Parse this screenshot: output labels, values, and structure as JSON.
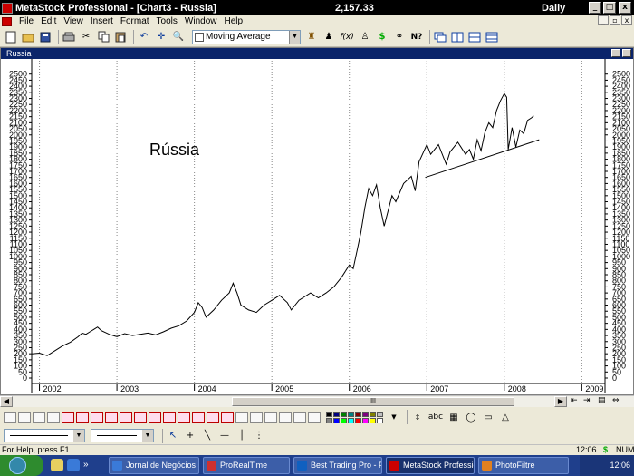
{
  "titlebar": {
    "title": "MetaStock Professional - [Chart3 - Russia]",
    "price": "2,157.33",
    "period": "Daily",
    "minimize": "_",
    "maximize": "□",
    "close": "x"
  },
  "menubar": {
    "items": [
      "File",
      "Edit",
      "View",
      "Insert",
      "Format",
      "Tools",
      "Window",
      "Help"
    ]
  },
  "toolbar": {
    "indicator_combo": "Moving Average",
    "fx_label": "f(x)",
    "dollar_label": "$",
    "help_label": "N?"
  },
  "chart_window": {
    "title": "Russia",
    "annotation": "Rússia"
  },
  "chart_data": {
    "type": "line",
    "title": "",
    "annotation": "Rússia",
    "xlabel": "",
    "ylabel": "",
    "x_tick_labels": [
      "2002",
      "2003",
      "2004",
      "2005",
      "2006",
      "2007",
      "2008",
      "2009"
    ],
    "y_ticks": [
      0,
      50,
      100,
      150,
      200,
      250,
      300,
      350,
      400,
      450,
      500,
      550,
      600,
      650,
      700,
      750,
      800,
      850,
      900,
      950,
      1000,
      1050,
      1100,
      1150,
      1200,
      1250,
      1300,
      1350,
      1400,
      1450,
      1500,
      1550,
      1600,
      1650,
      1700,
      1750,
      1800,
      1850,
      1900,
      1950,
      2000,
      2050,
      2100,
      2150,
      2200,
      2250,
      2300,
      2350,
      2400,
      2450,
      2500
    ],
    "ylim": [
      0,
      2550
    ],
    "xlim": [
      2001.9,
      2009.3
    ],
    "grid": "vertical dotted",
    "series": [
      {
        "points": [
          [
            2001.9,
            200
          ],
          [
            2002.0,
            205
          ],
          [
            2002.1,
            185
          ],
          [
            2002.2,
            225
          ],
          [
            2002.3,
            265
          ],
          [
            2002.4,
            295
          ],
          [
            2002.5,
            340
          ],
          [
            2002.55,
            370
          ],
          [
            2002.6,
            360
          ],
          [
            2002.65,
            380
          ],
          [
            2002.7,
            400
          ],
          [
            2002.75,
            420
          ],
          [
            2002.8,
            390
          ],
          [
            2002.9,
            360
          ],
          [
            2003.0,
            340
          ],
          [
            2003.1,
            365
          ],
          [
            2003.2,
            350
          ],
          [
            2003.3,
            360
          ],
          [
            2003.4,
            370
          ],
          [
            2003.5,
            355
          ],
          [
            2003.6,
            380
          ],
          [
            2003.7,
            410
          ],
          [
            2003.8,
            430
          ],
          [
            2003.9,
            470
          ],
          [
            2004.0,
            540
          ],
          [
            2004.05,
            620
          ],
          [
            2004.1,
            580
          ],
          [
            2004.15,
            500
          ],
          [
            2004.25,
            560
          ],
          [
            2004.35,
            640
          ],
          [
            2004.45,
            700
          ],
          [
            2004.5,
            780
          ],
          [
            2004.55,
            700
          ],
          [
            2004.6,
            600
          ],
          [
            2004.7,
            560
          ],
          [
            2004.8,
            540
          ],
          [
            2004.9,
            600
          ],
          [
            2005.0,
            640
          ],
          [
            2005.1,
            680
          ],
          [
            2005.2,
            620
          ],
          [
            2005.25,
            560
          ],
          [
            2005.35,
            640
          ],
          [
            2005.5,
            700
          ],
          [
            2005.6,
            660
          ],
          [
            2005.7,
            700
          ],
          [
            2005.8,
            750
          ],
          [
            2005.9,
            830
          ],
          [
            2006.0,
            930
          ],
          [
            2006.05,
            900
          ],
          [
            2006.1,
            1050
          ],
          [
            2006.15,
            1200
          ],
          [
            2006.2,
            1400
          ],
          [
            2006.25,
            1560
          ],
          [
            2006.3,
            1500
          ],
          [
            2006.35,
            1590
          ],
          [
            2006.4,
            1400
          ],
          [
            2006.45,
            1250
          ],
          [
            2006.55,
            1500
          ],
          [
            2006.6,
            1450
          ],
          [
            2006.7,
            1600
          ],
          [
            2006.8,
            1660
          ],
          [
            2006.85,
            1540
          ],
          [
            2006.9,
            1780
          ],
          [
            2006.95,
            1850
          ],
          [
            2007.0,
            1920
          ],
          [
            2007.05,
            1840
          ],
          [
            2007.15,
            1920
          ],
          [
            2007.25,
            1760
          ],
          [
            2007.3,
            1860
          ],
          [
            2007.4,
            1940
          ],
          [
            2007.5,
            1840
          ],
          [
            2007.55,
            1880
          ],
          [
            2007.6,
            1800
          ],
          [
            2007.65,
            1960
          ],
          [
            2007.7,
            1870
          ],
          [
            2007.75,
            2020
          ],
          [
            2007.8,
            2100
          ],
          [
            2007.85,
            2060
          ],
          [
            2007.9,
            2200
          ],
          [
            2007.95,
            2280
          ],
          [
            2008.0,
            2340
          ],
          [
            2008.03,
            2310
          ],
          [
            2008.05,
            1880
          ],
          [
            2008.1,
            2060
          ],
          [
            2008.15,
            1900
          ],
          [
            2008.2,
            2040
          ],
          [
            2008.25,
            2010
          ],
          [
            2008.3,
            2120
          ],
          [
            2008.35,
            2140
          ],
          [
            2008.38,
            2157
          ]
        ]
      }
    ],
    "trendline": [
      [
        2006.98,
        1650
      ],
      [
        2008.45,
        1960
      ]
    ]
  },
  "bottom_toolbar": {
    "text_tool": "abc",
    "palette": [
      "#000000",
      "#000080",
      "#008000",
      "#008080",
      "#800000",
      "#800080",
      "#808000",
      "#c0c0c0",
      "#808080",
      "#0000ff",
      "#00ff00",
      "#00ffff",
      "#ff0000",
      "#ff00ff",
      "#ffff00",
      "#ffffff"
    ]
  },
  "scrollbar": {
    "thumb_grip": "III"
  },
  "statusbar": {
    "help": "For Help, press F1",
    "clock": "12:06",
    "dollar": "$",
    "num": "NUM"
  },
  "taskbar": {
    "tasks": [
      "Jornal de Negócios ...",
      "ProRealTime",
      "Best Trading Pro - P...",
      "MetaStock Professio...",
      "PhotoFiltre"
    ],
    "clock": "12:06",
    "more": "»"
  }
}
